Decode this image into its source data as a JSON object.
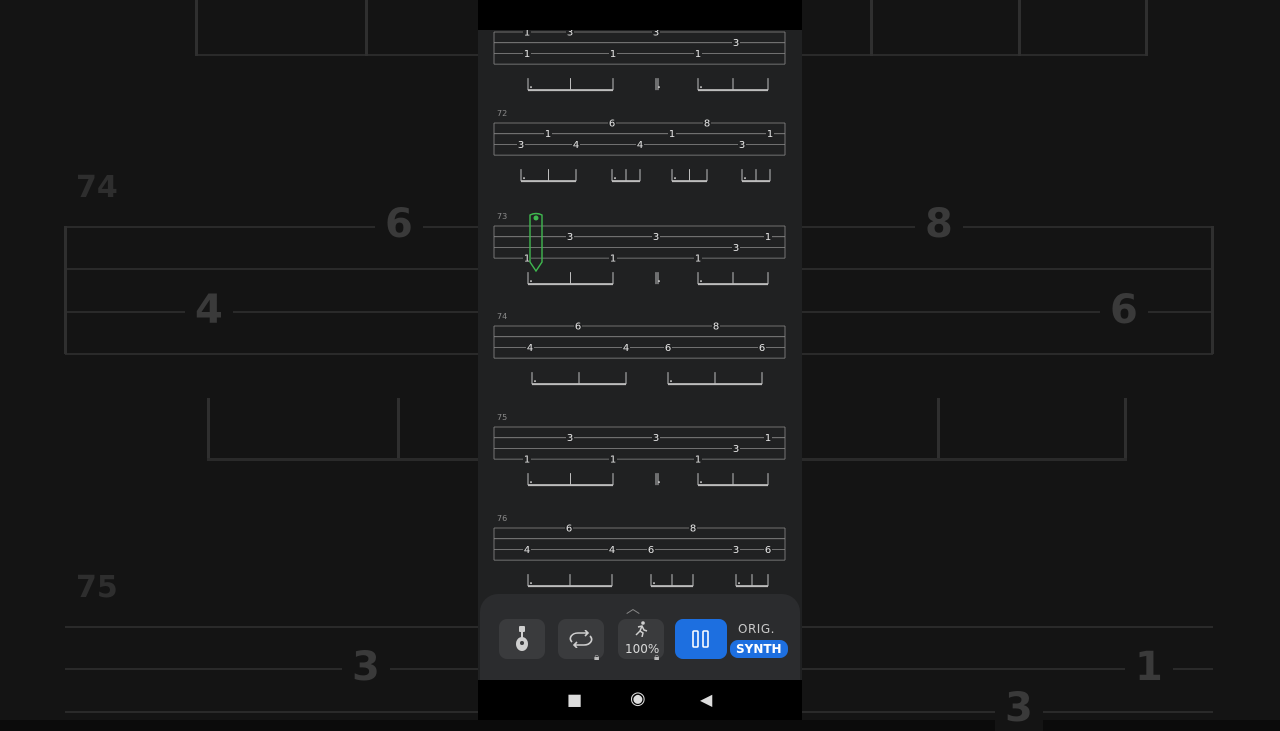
{
  "background": {
    "measure_labels": [
      "74",
      "75"
    ],
    "big_numbers": [
      "6",
      "8",
      "4",
      "6",
      "3",
      "1",
      "3"
    ]
  },
  "tab": {
    "measures": [
      {
        "number": "",
        "notes": [
          {
            "pos": "3",
            "string": 1
          },
          {
            "pos": "3",
            "string": 1
          },
          {
            "pos": "1",
            "string": 1
          },
          {
            "pos": "3",
            "string": 2
          },
          {
            "pos": "1",
            "string": 3
          },
          {
            "pos": "1",
            "string": 3
          },
          {
            "pos": "1",
            "string": 3
          }
        ]
      },
      {
        "number": "72",
        "notes": [
          {
            "pos": "6",
            "string": 1
          },
          {
            "pos": "8",
            "string": 1
          },
          {
            "pos": "1",
            "string": 2
          },
          {
            "pos": "1",
            "string": 2
          },
          {
            "pos": "1",
            "string": 2
          },
          {
            "pos": "3",
            "string": 3
          },
          {
            "pos": "4",
            "string": 3
          },
          {
            "pos": "4",
            "string": 3
          },
          {
            "pos": "3",
            "string": 3
          }
        ]
      },
      {
        "number": "73",
        "notes": [
          {
            "pos": "3",
            "string": 2
          },
          {
            "pos": "3",
            "string": 2
          },
          {
            "pos": "1",
            "string": 2
          },
          {
            "pos": "3",
            "string": 3
          },
          {
            "pos": "1",
            "string": 4
          },
          {
            "pos": "1",
            "string": 4
          },
          {
            "pos": "1",
            "string": 4
          }
        ]
      },
      {
        "number": "74",
        "notes": [
          {
            "pos": "6",
            "string": 1
          },
          {
            "pos": "8",
            "string": 1
          },
          {
            "pos": "4",
            "string": 3
          },
          {
            "pos": "4",
            "string": 3
          },
          {
            "pos": "6",
            "string": 3
          },
          {
            "pos": "6",
            "string": 3
          }
        ]
      },
      {
        "number": "75",
        "notes": [
          {
            "pos": "3",
            "string": 2
          },
          {
            "pos": "3",
            "string": 2
          },
          {
            "pos": "1",
            "string": 2
          },
          {
            "pos": "3",
            "string": 3
          },
          {
            "pos": "1",
            "string": 4
          },
          {
            "pos": "1",
            "string": 4
          },
          {
            "pos": "1",
            "string": 4
          }
        ]
      },
      {
        "number": "76",
        "notes": [
          {
            "pos": "6",
            "string": 1
          },
          {
            "pos": "8",
            "string": 1
          },
          {
            "pos": "4",
            "string": 3
          },
          {
            "pos": "4",
            "string": 3
          },
          {
            "pos": "6",
            "string": 3
          },
          {
            "pos": "3",
            "string": 3
          },
          {
            "pos": "6",
            "string": 3
          }
        ]
      }
    ]
  },
  "controls": {
    "tempo_percent": "100%",
    "orig_label": "ORIG.",
    "synth_label": "SYNTH",
    "play_state": "pause",
    "icons": [
      "guitar-icon",
      "loop-icon",
      "runner-icon",
      "pause-icon"
    ]
  },
  "colors": {
    "accent": "#1d6fe0",
    "cursor": "#3fb84f"
  }
}
